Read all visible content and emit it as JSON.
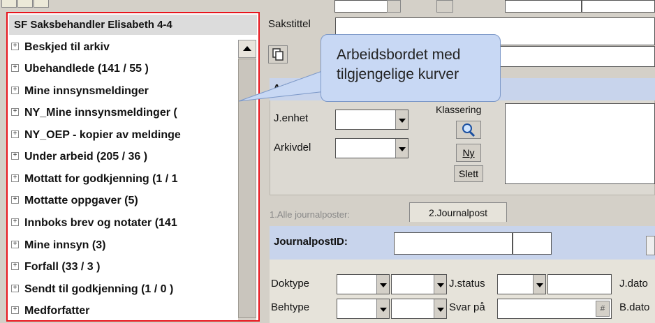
{
  "tree_panel": {
    "header": "SF Saksbehandler Elisabeth 4-4",
    "items": [
      {
        "label": "Beskjed til arkiv"
      },
      {
        "label": "Ubehandlede (141 / 55 )"
      },
      {
        "label": "Mine innsynsmeldinger"
      },
      {
        "label": "NY_Mine innsynsmeldinger ("
      },
      {
        "label": "NY_OEP - kopier av meldinge"
      },
      {
        "label": "Under arbeid (205 / 36 )"
      },
      {
        "label": "Mottatt for godkjenning (1 / 1"
      },
      {
        "label": "Mottatte oppgaver (5)"
      },
      {
        "label": "Innboks brev og notater (141"
      },
      {
        "label": "Mine innsyn (3)"
      },
      {
        "label": "Forfall (33 / 3 )"
      },
      {
        "label": "Sendt til godkjenning (1 / 0 )"
      },
      {
        "label": "Medforfatter"
      }
    ],
    "expand_glyph": "+"
  },
  "form": {
    "sakstittel_label": "Sakstittel",
    "arkiv_label": "Arkiv",
    "jenhet_label": "J.enhet",
    "arkivdel_label": "Arkivdel",
    "klassering_label": "Klassering",
    "ny_button": "Ny",
    "slett_button": "Slett"
  },
  "tabs": {
    "tab1_label": "1.Alle journalposter:",
    "tab2_label": "2.Journalpost"
  },
  "journalpost": {
    "id_label": "JournalpostID:",
    "doktype_label": "Doktype",
    "jstatus_label": "J.status",
    "jdato_label": "J.dato",
    "behtype_label": "Behtype",
    "svarpa_label": "Svar på",
    "bdato_label": "B.dato",
    "hash_button": "#"
  },
  "callout": {
    "text": "Arbeidsbordet med tilgjengelige kurver"
  },
  "colors": {
    "highlight_border": "#e8141c",
    "callout_fill": "#c8d8f4",
    "section_header": "#c8d4ec"
  }
}
